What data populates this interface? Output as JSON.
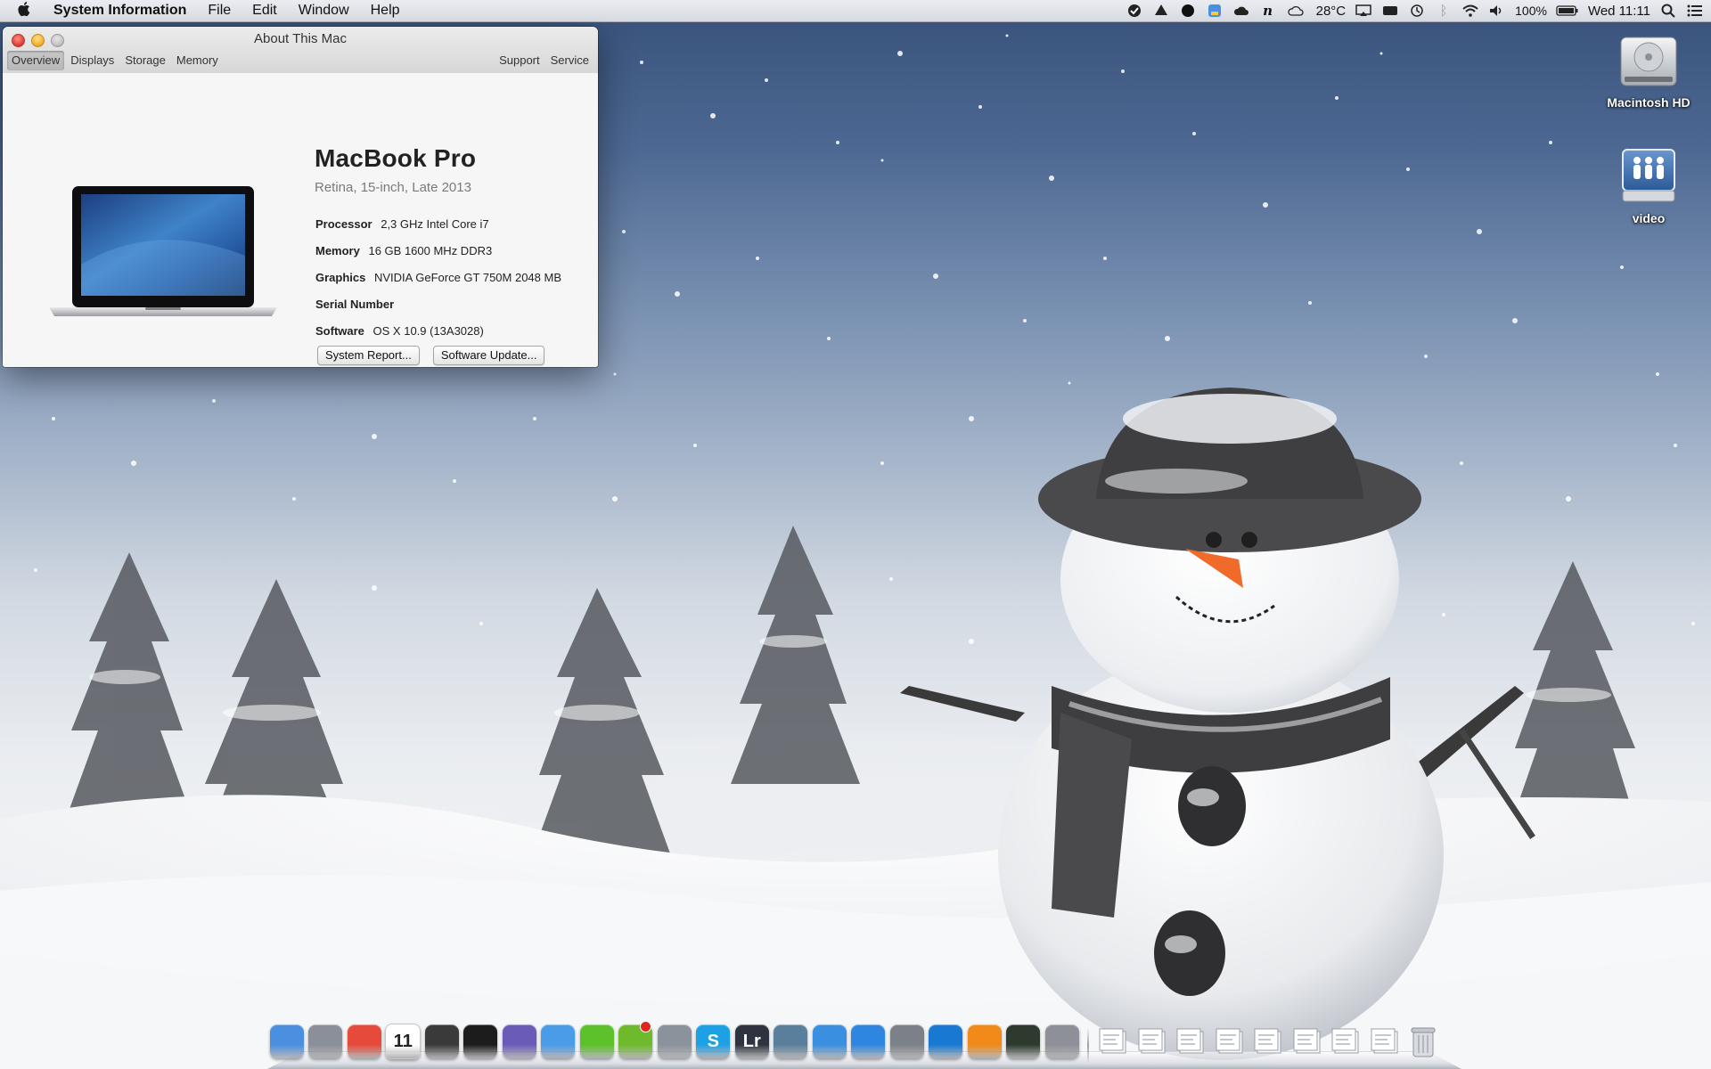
{
  "menubar": {
    "app_name": "System Information",
    "menus": [
      "File",
      "Edit",
      "Window",
      "Help"
    ],
    "temperature": "28°C",
    "battery": "100%",
    "clock": "Wed 11:11"
  },
  "window": {
    "title": "About This Mac",
    "tabs": [
      "Overview",
      "Displays",
      "Storage",
      "Memory"
    ],
    "active_tab": "Overview",
    "right_tabs": [
      "Support",
      "Service"
    ],
    "model_name": "MacBook Pro",
    "model_sub": "Retina, 15-inch, Late 2013",
    "specs": [
      {
        "label": "Processor",
        "value": "2,3 GHz Intel Core i7"
      },
      {
        "label": "Memory",
        "value": "16 GB 1600 MHz DDR3"
      },
      {
        "label": "Graphics",
        "value": "NVIDIA GeForce GT 750M 2048 MB"
      },
      {
        "label": "Serial Number",
        "value": ""
      },
      {
        "label": "Software",
        "value": "OS X 10.9 (13A3028)"
      }
    ],
    "buttons": {
      "system_report": "System Report...",
      "software_update": "Software Update..."
    }
  },
  "desktop_icons": [
    {
      "label": "Macintosh HD",
      "icon": "hard-drive-icon"
    },
    {
      "label": "video",
      "icon": "network-share-icon"
    }
  ],
  "dock": {
    "apps": [
      {
        "name": "finder-icon",
        "color": "#4a8fe0"
      },
      {
        "name": "launchpad-icon",
        "color": "#8a8f99"
      },
      {
        "name": "chrome-icon",
        "color": "#e64a3a"
      },
      {
        "name": "calendar-icon",
        "color": "#ffffff",
        "text": "11"
      },
      {
        "name": "tornado-icon",
        "color": "#3a3a3a"
      },
      {
        "name": "terminal-icon",
        "color": "#1c1c1c"
      },
      {
        "name": "eclipse-icon",
        "color": "#6b5bb8"
      },
      {
        "name": "messages-icon",
        "color": "#4a9be8"
      },
      {
        "name": "lime-icon",
        "color": "#5cc12a"
      },
      {
        "name": "spotify-icon",
        "color": "#6fba2c",
        "badge": true
      },
      {
        "name": "camera-icon",
        "color": "#8a929c"
      },
      {
        "name": "skype-icon",
        "color": "#1ea0e5",
        "text": "S"
      },
      {
        "name": "lightroom-icon",
        "color": "#2d3440",
        "text": "Lr"
      },
      {
        "name": "preview-icon",
        "color": "#5a7f9c"
      },
      {
        "name": "itunes-icon",
        "color": "#3a8fe0"
      },
      {
        "name": "app-store-icon",
        "color": "#2f86e0"
      },
      {
        "name": "system-preferences-icon",
        "color": "#7c8088"
      },
      {
        "name": "teamviewer-icon",
        "color": "#1979d2"
      },
      {
        "name": "vlc-icon",
        "color": "#f28a1a"
      },
      {
        "name": "activity-monitor-icon",
        "color": "#2d3a2d"
      },
      {
        "name": "automator-icon",
        "color": "#8d9098"
      }
    ],
    "docs": [
      {
        "name": "document-stack-icon"
      },
      {
        "name": "document-stack-icon"
      },
      {
        "name": "document-stack-icon"
      },
      {
        "name": "document-stack-icon"
      },
      {
        "name": "document-stack-icon"
      },
      {
        "name": "document-stack-icon"
      },
      {
        "name": "document-stack-icon"
      },
      {
        "name": "document-stack-icon"
      },
      {
        "name": "trash-icon"
      }
    ]
  }
}
